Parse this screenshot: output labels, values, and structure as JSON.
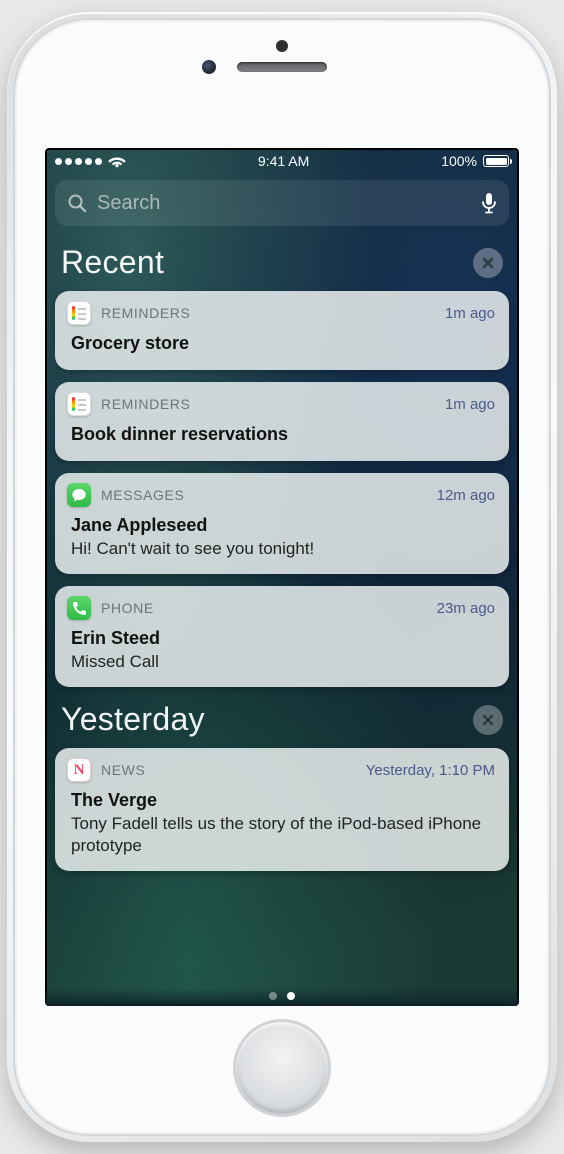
{
  "status": {
    "time": "9:41 AM",
    "battery_pct": "100%"
  },
  "search": {
    "placeholder": "Search"
  },
  "sections": [
    {
      "title": "Recent",
      "items": [
        {
          "app": "REMINDERS",
          "icon": "reminders",
          "time": "1m ago",
          "title": "Grocery store",
          "body": ""
        },
        {
          "app": "REMINDERS",
          "icon": "reminders",
          "time": "1m ago",
          "title": "Book dinner reservations",
          "body": ""
        },
        {
          "app": "MESSAGES",
          "icon": "messages",
          "time": "12m ago",
          "title": "Jane Appleseed",
          "body": "Hi! Can't wait to see you tonight!"
        },
        {
          "app": "PHONE",
          "icon": "phone",
          "time": "23m ago",
          "title": "Erin Steed",
          "body": "Missed Call"
        }
      ]
    },
    {
      "title": "Yesterday",
      "items": [
        {
          "app": "NEWS",
          "icon": "news",
          "time": "Yesterday, 1:10 PM",
          "title": "The Verge",
          "body": "Tony Fadell tells us the story of the iPod-based iPhone prototype"
        }
      ]
    }
  ],
  "pager": {
    "count": 2,
    "active": 1
  }
}
